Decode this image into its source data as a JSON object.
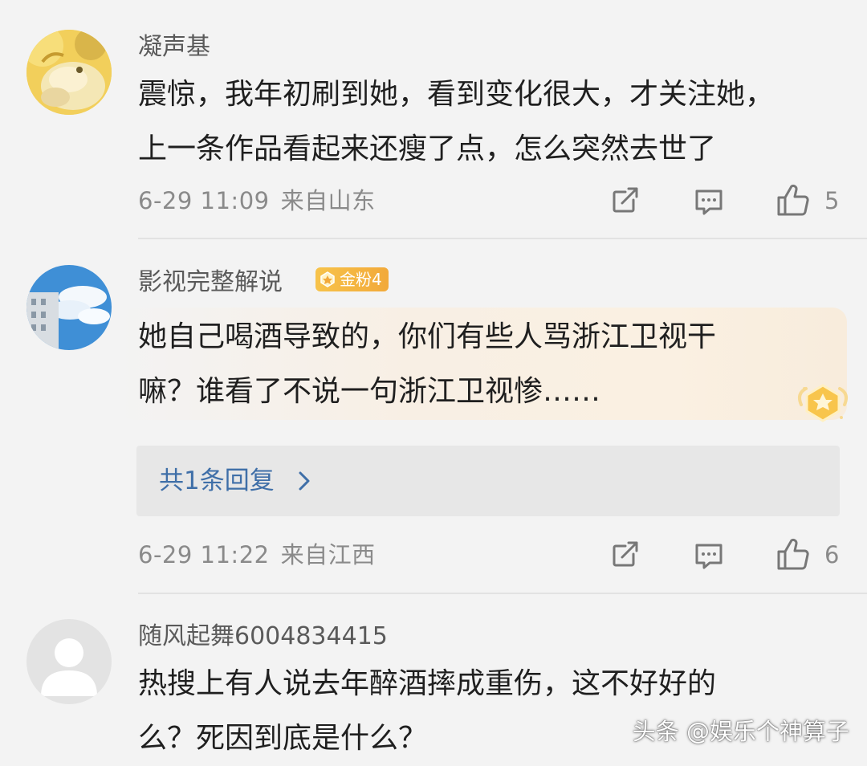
{
  "comments": [
    {
      "username": "凝声基",
      "lines": [
        "震惊，我年初刷到她，看到变化很大，才关注她，",
        "上一条作品看起来还瘦了点，怎么突然去世了"
      ],
      "date": "6-29 11:09",
      "location": "来自山东",
      "likes": "5",
      "avatar": "cartoon-duck-avatar"
    },
    {
      "username": "影视完整解说",
      "badge": "金粉4",
      "lines": [
        "她自己喝酒导致的，你们有些人骂浙江卫视干",
        "嘛？谁看了不说一句浙江卫视惨……"
      ],
      "reply_label": "共1条回复",
      "date": "6-29 11:22",
      "location": "来自江西",
      "likes": "6",
      "avatar": "sky-building-avatar"
    },
    {
      "username": "随风起舞6004834415",
      "lines": [
        "热搜上有人说去年醉酒摔成重伤，这不好好的",
        "么？死因到底是什么？"
      ],
      "avatar": "default-user-avatar"
    }
  ],
  "watermark": "头条 @娱乐个神算子",
  "colors": {
    "background": "#f3f3f3",
    "reply_link": "#3f6fa8",
    "badge": "#f2a93a",
    "meta_text": "#8a8a8a"
  }
}
